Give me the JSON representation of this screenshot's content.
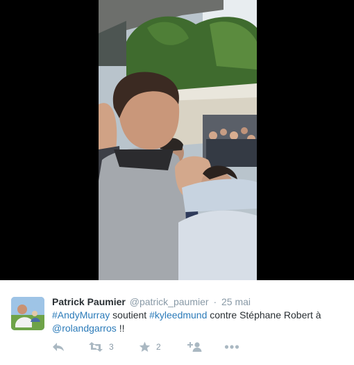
{
  "tweet": {
    "author_name": "Patrick Paumier",
    "author_handle": "@patrick_paumier",
    "separator": "·",
    "date": "25 mai",
    "text_parts": {
      "hashtag_1": "#AndyMurray",
      "plain_1": " soutient ",
      "hashtag_2": "#kyleedmund",
      "plain_2": " contre Stéphane Robert à ",
      "mention": "@rolandgarros",
      "plain_3": " !!"
    },
    "retweet_count": "3",
    "favorite_count": "2"
  },
  "icons": {
    "reply": "reply-icon",
    "retweet": "retweet-icon",
    "favorite": "star-icon",
    "follow": "follow-user-icon",
    "more": "more-icon"
  },
  "colors": {
    "link": "#2b7bb9",
    "name": "#292f33",
    "muted": "#8899a6",
    "action_icon": "#aab8c2"
  }
}
